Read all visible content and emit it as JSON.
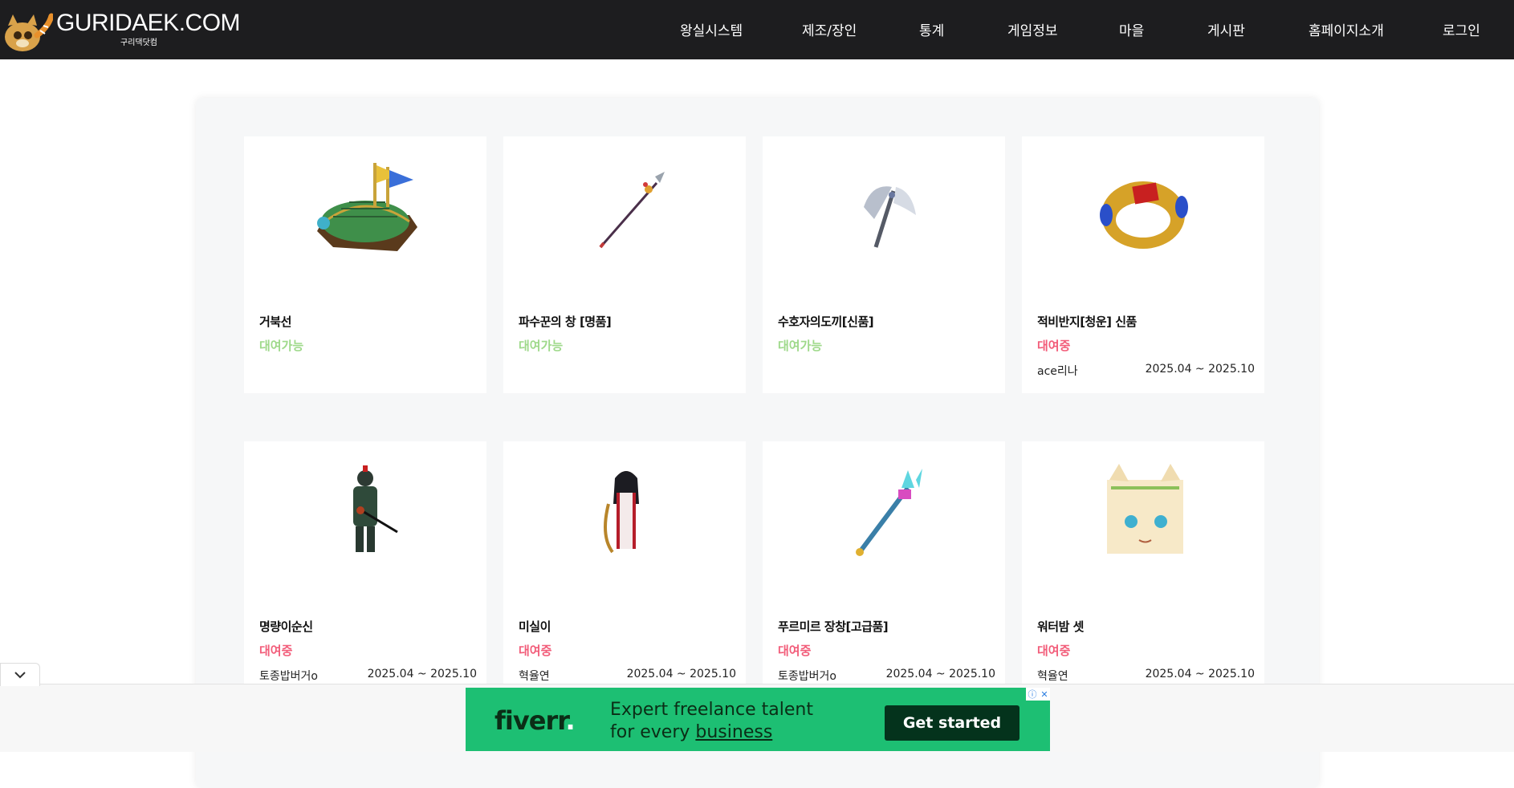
{
  "header": {
    "logo_text": "GURIDAEK.COM",
    "logo_sub": "구리댁닷컴",
    "nav": [
      {
        "label": "왕실시스템"
      },
      {
        "label": "제조/장인"
      },
      {
        "label": "통계"
      },
      {
        "label": "게임정보"
      },
      {
        "label": "마을"
      },
      {
        "label": "게시판"
      },
      {
        "label": "홈페이지소개"
      },
      {
        "label": "로그인"
      }
    ]
  },
  "items": [
    {
      "name": "거북선",
      "status": "대여가능",
      "renter": "",
      "period": "",
      "icon": "turtle-ship-icon"
    },
    {
      "name": "파수꾼의 창 [명품]",
      "status": "대여가능",
      "renter": "",
      "period": "",
      "icon": "spear-icon"
    },
    {
      "name": "수호자의도끼[신품]",
      "status": "대여가능",
      "renter": "",
      "period": "",
      "icon": "axe-icon"
    },
    {
      "name": "적비반지[청운] 신품",
      "status": "대여중",
      "renter": "ace리나",
      "period": "2025.04 ~ 2025.10",
      "icon": "ring-icon"
    },
    {
      "name": "명량이순신",
      "status": "대여중",
      "renter": "토종밥버거o",
      "period": "2025.04 ~ 2025.10",
      "icon": "warrior-icon"
    },
    {
      "name": "미실이",
      "status": "대여중",
      "renter": "혁율연",
      "period": "2025.04 ~ 2025.10",
      "icon": "lady-icon"
    },
    {
      "name": "푸르미르 장창[고급품]",
      "status": "대여중",
      "renter": "토종밥버거o",
      "period": "2025.04 ~ 2025.10",
      "icon": "blue-spear-icon"
    },
    {
      "name": "워터밤 셋",
      "status": "대여중",
      "renter": "혁율연",
      "period": "2025.04 ~ 2025.10",
      "icon": "cat-girl-icon"
    }
  ],
  "ad": {
    "brand": "fiverr",
    "brand_dot": ".",
    "line1": "Expert freelance talent",
    "line2_prefix": "for every ",
    "line2_link": "business",
    "cta": "Get started",
    "info_icon": "info-icon",
    "close_label": "✕"
  },
  "colors": {
    "header_bg": "#1d1d1f",
    "available": "#9ed98a",
    "rented": "#f25c79",
    "ad_bg": "#1dbf73"
  }
}
